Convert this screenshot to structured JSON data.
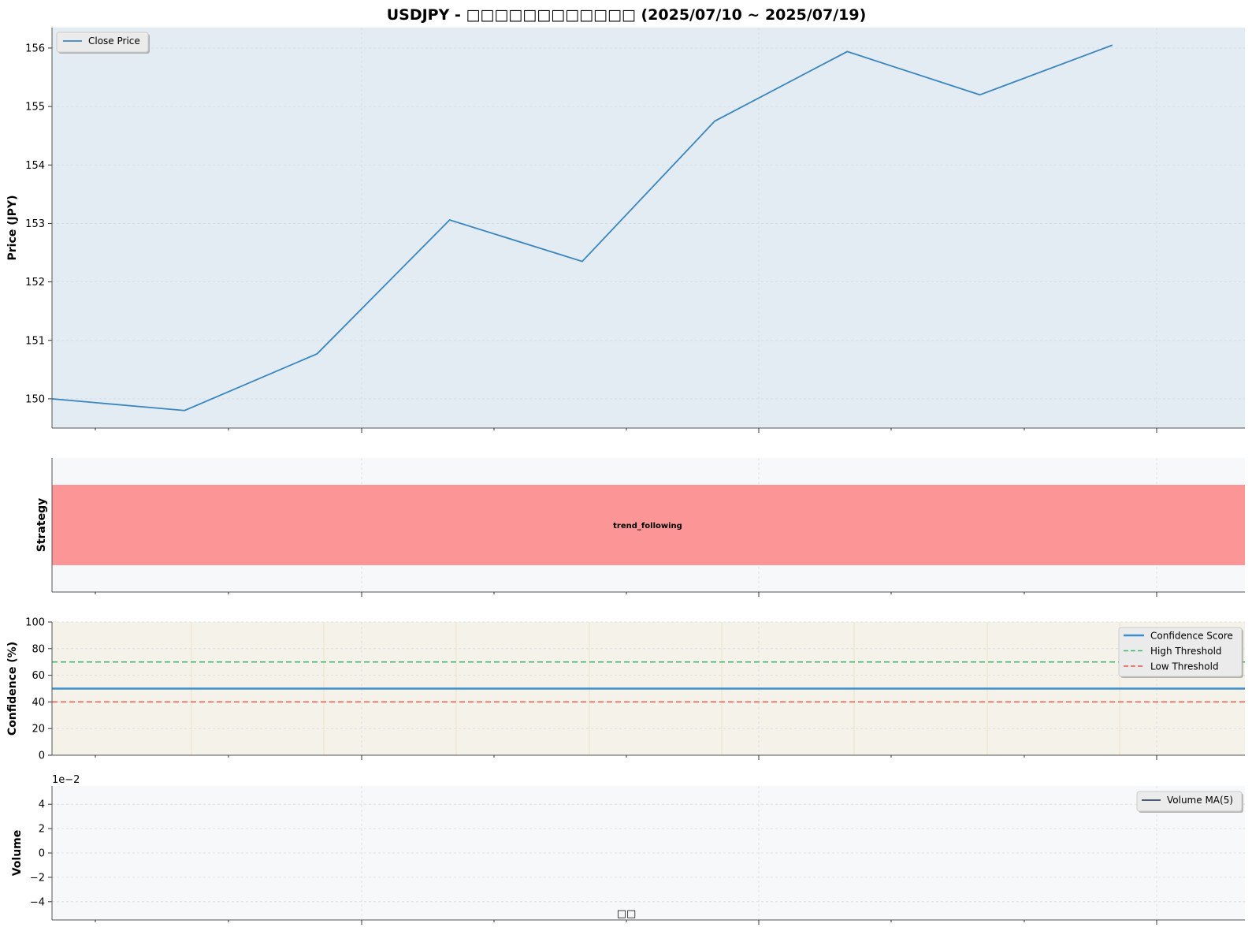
{
  "title": "USDJPY - □□□□□□□□□□□□ (2025/07/10 ~ 2025/07/19)",
  "colors": {
    "price_line": "#3a87c0",
    "price_bg": "#e3ebf3",
    "strategy_band": "#fc9696",
    "panel_bg": "#f7f8fa",
    "confidence_line": "#3a8ed0",
    "confidence_bg": "#f5f2ea",
    "high_threshold": "#3fb871",
    "low_threshold": "#e55b4d",
    "volume_ma": "#34495e"
  },
  "chart_data": [
    {
      "type": "line",
      "ylabel": "Price (JPY)",
      "ylim": [
        149.5,
        156.35
      ],
      "yticks": [
        "150",
        "151",
        "152",
        "153",
        "154",
        "155",
        "156"
      ],
      "grid": true,
      "legend": "top-left",
      "series": [
        {
          "name": "Close Price",
          "values": [
            150.0,
            149.8,
            150.77,
            153.06,
            152.35,
            154.75,
            155.94,
            155.2,
            156.05
          ]
        }
      ]
    },
    {
      "type": "area",
      "ylabel": "Strategy",
      "bands": [
        {
          "label": "trend_following",
          "start": 0,
          "end": 9
        }
      ]
    },
    {
      "type": "line",
      "ylabel": "Confidence (%)",
      "ylim": [
        0,
        100
      ],
      "yticks": [
        "0",
        "20",
        "40",
        "60",
        "80",
        "100"
      ],
      "grid": true,
      "legend": "top-right",
      "series": [
        {
          "name": "Confidence Score",
          "values": [
            50,
            50,
            50,
            50,
            50,
            50,
            50,
            50,
            50,
            50
          ]
        },
        {
          "name": "High Threshold",
          "values": [
            70,
            70,
            70,
            70,
            70,
            70,
            70,
            70,
            70,
            70
          ]
        },
        {
          "name": "Low Threshold",
          "values": [
            40,
            40,
            40,
            40,
            40,
            40,
            40,
            40,
            40,
            40
          ]
        }
      ]
    },
    {
      "type": "line",
      "ylabel": "Volume",
      "offset_label": "1e−2",
      "ylim": [
        -5.5,
        5.5
      ],
      "yticks": [
        "−4",
        "−2",
        "0",
        "2",
        "4"
      ],
      "grid": true,
      "legend": "top-right",
      "xlabel": "□□",
      "series": [
        {
          "name": "Volume MA(5)",
          "values": []
        }
      ]
    }
  ]
}
